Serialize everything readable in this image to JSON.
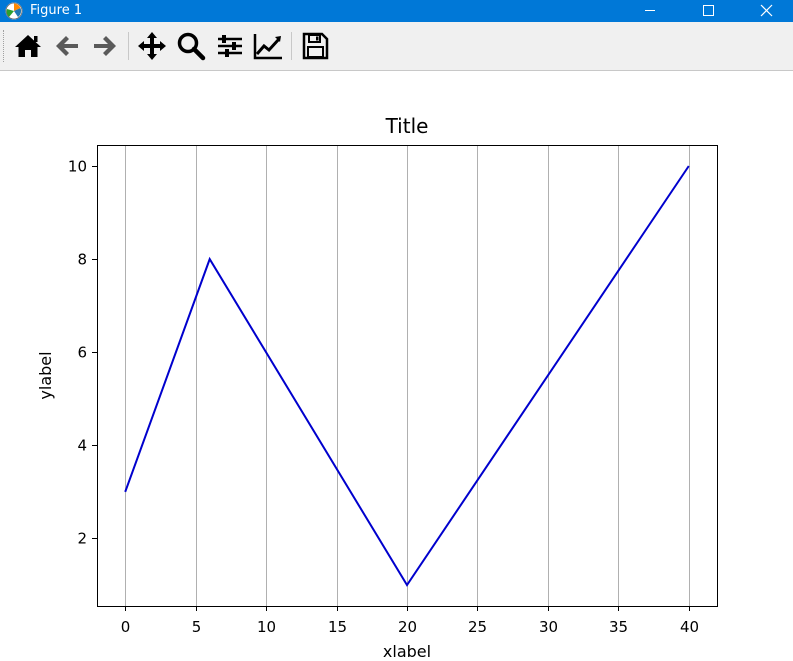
{
  "window": {
    "title": "Figure 1"
  },
  "toolbar": {
    "tools": [
      {
        "icon": "home-icon",
        "label": "Home"
      },
      {
        "icon": "arrow-left-icon",
        "label": "Back"
      },
      {
        "icon": "arrow-right-icon",
        "label": "Forward"
      },
      {
        "icon": "move-icon",
        "label": "Pan"
      },
      {
        "icon": "magnifier-icon",
        "label": "Zoom"
      },
      {
        "icon": "sliders-icon",
        "label": "Subplots"
      },
      {
        "icon": "line-chart-icon",
        "label": "Customize"
      },
      {
        "icon": "floppy-disk-icon",
        "label": "Save"
      }
    ]
  },
  "chart_data": {
    "type": "line",
    "title": "Title",
    "xlabel": "xlabel",
    "ylabel": "ylabel",
    "x": [
      0,
      6,
      20,
      40
    ],
    "series": [
      {
        "values": [
          3,
          8,
          1,
          10
        ],
        "color": "#0000cd"
      }
    ],
    "xlim": [
      -2,
      42
    ],
    "ylim": [
      0.55,
      10.45
    ],
    "xticks": [
      0,
      5,
      10,
      15,
      20,
      25,
      30,
      35,
      40
    ],
    "yticks": [
      2,
      4,
      6,
      8,
      10
    ],
    "grid": "x-vertical",
    "grid_color": "#b0b0b0"
  }
}
